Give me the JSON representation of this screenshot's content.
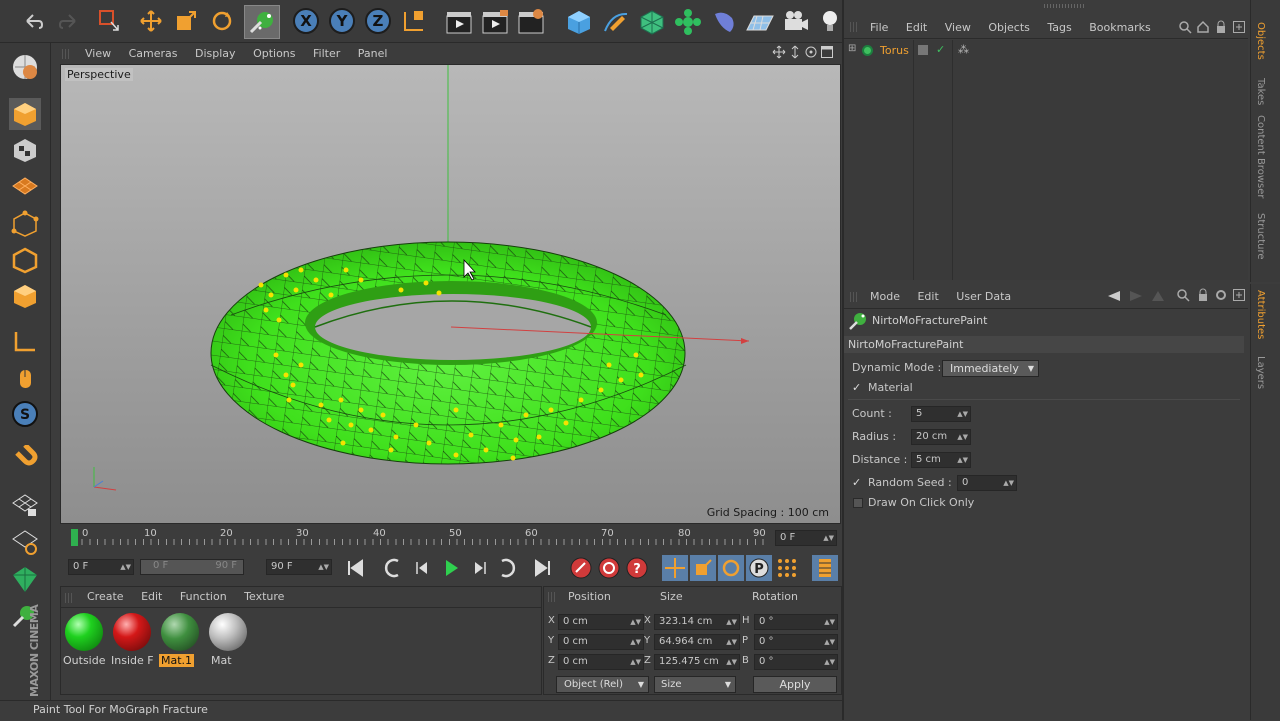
{
  "viewport": {
    "menu": [
      "View",
      "Cameras",
      "Display",
      "Options",
      "Filter",
      "Panel"
    ],
    "label": "Perspective",
    "grid_spacing": "Grid Spacing : 100 cm"
  },
  "objects_panel": {
    "menu": [
      "File",
      "Edit",
      "View",
      "Objects",
      "Tags",
      "Bookmarks"
    ],
    "object_name": "Torus",
    "side_tabs": [
      "Objects",
      "Takes",
      "Content Browser",
      "Structure"
    ]
  },
  "attributes_panel": {
    "menu": [
      "Mode",
      "Edit",
      "User Data"
    ],
    "tool_name": "NirtoMoFracturePaint",
    "section_title": "NirtoMoFracturePaint",
    "dynamic_mode_label": "Dynamic Mode",
    "dynamic_mode_value": "Immediately",
    "material_label": "Material",
    "count_label": "Count",
    "count_value": "5",
    "radius_label": "Radius",
    "radius_value": "20 cm",
    "distance_label": "Distance",
    "distance_value": "5 cm",
    "random_seed_label": "Random Seed",
    "random_seed_value": "0",
    "draw_on_click_label": "Draw On Click Only",
    "side_tabs": [
      "Attributes",
      "Layers"
    ]
  },
  "timeline": {
    "ticks": [
      "0",
      "10",
      "20",
      "30",
      "40",
      "50",
      "60",
      "70",
      "80",
      "90"
    ],
    "current_frame": "0 F",
    "start_field": "0 F",
    "range_start": "0 F",
    "range_end": "90 F",
    "end_field": "90 F"
  },
  "material_manager": {
    "menu": [
      "Create",
      "Edit",
      "Function",
      "Texture"
    ],
    "materials": [
      {
        "name": "Outside",
        "color": "#1fd11f"
      },
      {
        "name": "Inside F",
        "color": "#d41818"
      },
      {
        "name": "Mat.1",
        "color": "#3f8f3f"
      },
      {
        "name": "Mat",
        "color": "#bdbdbd"
      }
    ]
  },
  "coordinates": {
    "headers": [
      "Position",
      "Size",
      "Rotation"
    ],
    "pos": [
      {
        "axis": "X",
        "value": "0 cm"
      },
      {
        "axis": "Y",
        "value": "0 cm"
      },
      {
        "axis": "Z",
        "value": "0 cm"
      }
    ],
    "size": [
      {
        "axis": "X",
        "value": "323.14 cm"
      },
      {
        "axis": "Y",
        "value": "64.964 cm"
      },
      {
        "axis": "Z",
        "value": "125.475 cm"
      }
    ],
    "rot": [
      {
        "axis": "H",
        "value": "0 °"
      },
      {
        "axis": "P",
        "value": "0 °"
      },
      {
        "axis": "B",
        "value": "0 °"
      }
    ],
    "mode_select": "Object (Rel)",
    "size_select": "Size",
    "apply": "Apply"
  },
  "status_text": "Paint Tool For MoGraph Fracture",
  "brand": "MAXON CINEMA",
  "colors": {
    "accent": "#f0a030",
    "torus": "#3fe01c",
    "selection": "#5a9fd6"
  }
}
